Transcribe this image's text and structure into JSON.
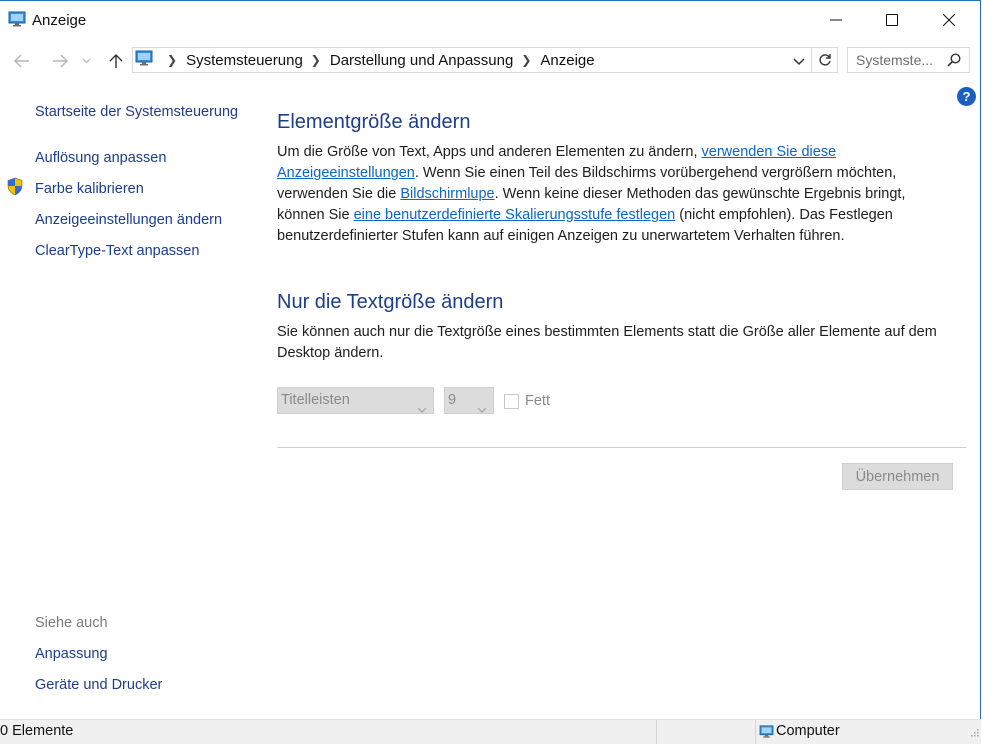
{
  "window": {
    "title": "Anzeige"
  },
  "navigation": {
    "breadcrumbs": [
      "Systemsteuerung",
      "Darstellung und Anpassung",
      "Anzeige"
    ],
    "search_placeholder": "Systemste..."
  },
  "sidebar": {
    "home_link": "Startseite der Systemsteuerung",
    "links": [
      "Auflösung anpassen",
      "Farbe kalibrieren",
      "Anzeigeeinstellungen ändern",
      "ClearType-Text anpassen"
    ],
    "see_also_heading": "Siehe auch",
    "see_also_links": [
      "Anpassung",
      "Geräte und Drucker"
    ]
  },
  "main": {
    "section1": {
      "heading": "Elementgröße ändern",
      "text_a": "Um die Größe von Text, Apps und anderen Elementen zu ändern, ",
      "link_a": "verwenden Sie diese Anzeigeeinstellungen",
      "text_b": ". Wenn Sie einen Teil des Bildschirms vorübergehend vergrößern möchten, verwenden Sie die ",
      "link_b": "Bildschirmlupe",
      "text_c": ". Wenn keine dieser Methoden das gewünschte Ergebnis bringt, können Sie ",
      "link_c": "eine benutzerdefinierte Skalierungsstufe festlegen",
      "text_d": " (nicht empfohlen). Das Festlegen benutzerdefinierter Stufen kann auf einigen Anzeigen zu unerwartetem Verhalten führen."
    },
    "section2": {
      "heading": "Nur die Textgröße ändern",
      "text": "Sie können auch nur die Textgröße eines bestimmten Elements statt die Größe aller Elemente auf dem Desktop ändern.",
      "element_select_value": "Titelleisten",
      "size_select_value": "9",
      "bold_label": "Fett",
      "bold_checked": false,
      "apply_label": "Übernehmen"
    }
  },
  "statusbar": {
    "items_count": "0 Elemente",
    "location": "Computer"
  },
  "colors": {
    "link": "#0b66c8",
    "heading": "#1c3e8c",
    "window_border": "#1f6fc5",
    "help": "#1a5fc2"
  }
}
